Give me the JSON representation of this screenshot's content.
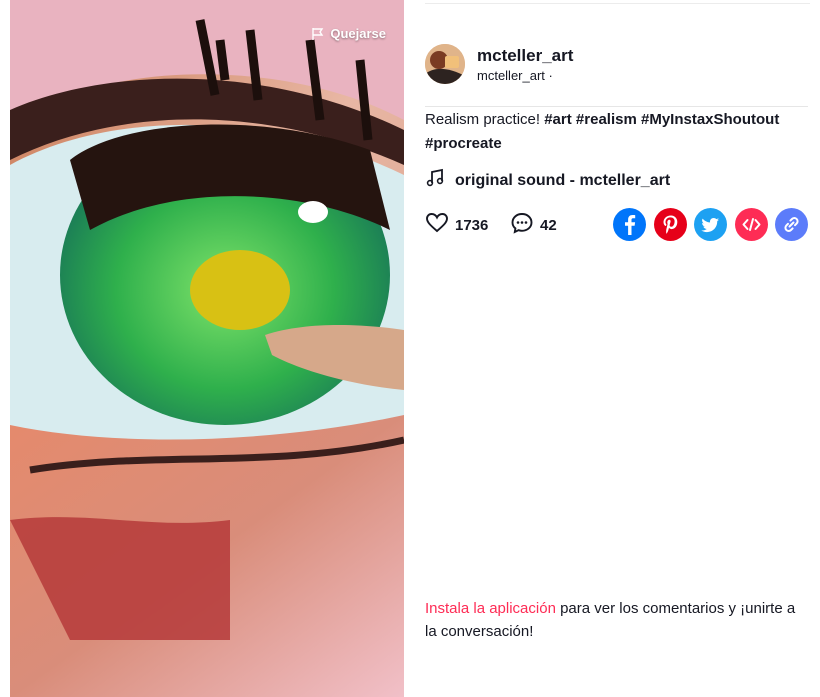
{
  "video": {
    "report_label": "Quejarse",
    "icons": {
      "report": "flag-icon"
    }
  },
  "author": {
    "name": "mcteller_art",
    "subtitle": "mcteller_art ·",
    "avatar_icon": "avatar-image"
  },
  "description": {
    "text": "Realism practice!",
    "hashtags": [
      "#art",
      "#realism",
      "#MyInstaxShoutout",
      "#procreate"
    ]
  },
  "music": {
    "title": "original sound - mcteller_art",
    "icon": "music-note-icon"
  },
  "stats": {
    "likes": "1736",
    "comments": "42",
    "icons": {
      "likes": "heart-icon",
      "comments": "comment-icon"
    }
  },
  "share": [
    {
      "name": "facebook",
      "icon": "facebook-icon",
      "color": "#0075fa"
    },
    {
      "name": "pinterest",
      "icon": "pinterest-icon",
      "color": "#e60019"
    },
    {
      "name": "twitter",
      "icon": "twitter-icon",
      "color": "#1da1f2"
    },
    {
      "name": "embed",
      "icon": "embed-icon",
      "color": "#fe2c55"
    },
    {
      "name": "copy-link",
      "icon": "link-icon",
      "color": "#5c7cfa"
    }
  ],
  "install_prompt": {
    "link_text": "Instala la aplicación",
    "rest_text": " para ver los comentarios y ¡unirte a la conversación!"
  },
  "colors": {
    "accent": "#fe2c55",
    "text": "#161823"
  }
}
